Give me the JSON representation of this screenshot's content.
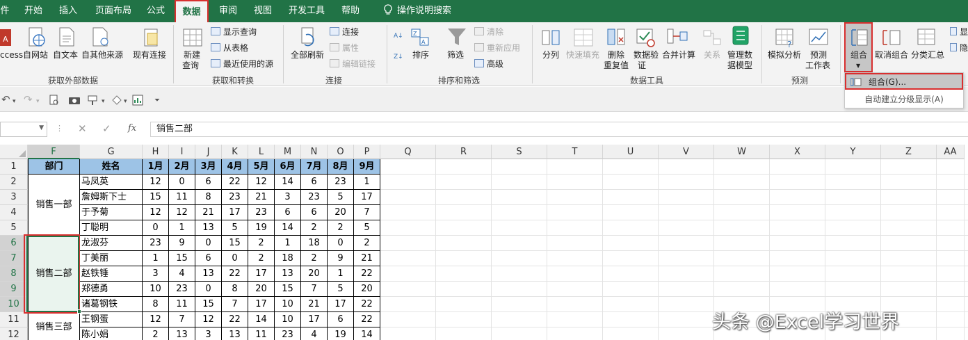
{
  "tabs": [
    {
      "label": "件"
    },
    {
      "label": "开始"
    },
    {
      "label": "插入"
    },
    {
      "label": "页面布局"
    },
    {
      "label": "公式"
    },
    {
      "label": "数据"
    },
    {
      "label": "审阅"
    },
    {
      "label": "视图"
    },
    {
      "label": "开发工具"
    },
    {
      "label": "帮助"
    }
  ],
  "tell_me": "操作说明搜索",
  "ribbon": {
    "ext": {
      "access": "ccess",
      "web": "自网站",
      "text": "自文本",
      "other": "自其他来源",
      "existing": "现有连接",
      "group": "获取外部数据"
    },
    "transform": {
      "new_query_l1": "新建",
      "new_query_l2": "查询",
      "show_query": "显示查询",
      "from_table": "从表格",
      "recent": "最近使用的源",
      "group": "获取和转换"
    },
    "conn": {
      "refresh_all": "全部刷新",
      "connections": "连接",
      "properties": "属性",
      "edit_links": "编辑链接",
      "group": "连接"
    },
    "sort": {
      "sort": "排序",
      "filter": "筛选",
      "clear": "清除",
      "reapply": "重新应用",
      "advanced": "高级",
      "group": "排序和筛选"
    },
    "tools": {
      "split": "分列",
      "flash_fill": "快速填充",
      "remove_dup_l1": "删除",
      "remove_dup_l2": "重复值",
      "validate_l1": "数据验",
      "validate_l2": "证",
      "consolidate": "合并计算",
      "relations": "关系",
      "model_l1": "管理数",
      "model_l2": "据模型",
      "group": "数据工具"
    },
    "forecast": {
      "whatif": "模拟分析",
      "sheet_l1": "预测",
      "sheet_l2": "工作表",
      "group": "预测"
    },
    "outline": {
      "group_btn": "组合",
      "ungroup": "取消组合",
      "subtotal": "分类汇总",
      "show": "显",
      "hide": "隐"
    }
  },
  "dropdown": {
    "group": "组合(G)...",
    "auto": "自动建立分级显示(A)"
  },
  "formula": {
    "value": "销售二部",
    "fx": "fx"
  },
  "col_headers": [
    {
      "label": "F",
      "w": 75
    },
    {
      "label": "G",
      "w": 90
    },
    {
      "label": "H",
      "w": 38
    },
    {
      "label": "I",
      "w": 38
    },
    {
      "label": "J",
      "w": 38
    },
    {
      "label": "K",
      "w": 38
    },
    {
      "label": "L",
      "w": 38
    },
    {
      "label": "M",
      "w": 38
    },
    {
      "label": "N",
      "w": 38
    },
    {
      "label": "O",
      "w": 38
    },
    {
      "label": "P",
      "w": 38
    },
    {
      "label": "Q",
      "w": 80
    },
    {
      "label": "R",
      "w": 80
    },
    {
      "label": "S",
      "w": 80
    },
    {
      "label": "T",
      "w": 80
    },
    {
      "label": "U",
      "w": 80
    },
    {
      "label": "V",
      "w": 80
    },
    {
      "label": "W",
      "w": 80
    },
    {
      "label": "X",
      "w": 80
    },
    {
      "label": "Y",
      "w": 80
    },
    {
      "label": "Z",
      "w": 80
    },
    {
      "label": "AA",
      "w": 40
    }
  ],
  "row_numbers": [
    "1",
    "2",
    "3",
    "4",
    "5",
    "6",
    "7",
    "8",
    "9",
    "10",
    "11",
    "12"
  ],
  "header_row": [
    "部门",
    "姓名",
    "1月",
    "2月",
    "3月",
    "4月",
    "5月",
    "6月",
    "7月",
    "8月",
    "9月"
  ],
  "departments": [
    {
      "name": "销售一部",
      "start": 1,
      "span": 4
    },
    {
      "name": "销售二部",
      "start": 5,
      "span": 5
    },
    {
      "name": "销售三部",
      "start": 10,
      "span": 2
    }
  ],
  "rows": [
    {
      "name": "马凤英",
      "m": [
        "12",
        "0",
        "6",
        "22",
        "12",
        "14",
        "6",
        "23",
        "1"
      ]
    },
    {
      "name": "詹姆斯下士",
      "m": [
        "15",
        "11",
        "8",
        "23",
        "21",
        "3",
        "23",
        "5",
        "17"
      ]
    },
    {
      "name": "于予菊",
      "m": [
        "12",
        "12",
        "21",
        "17",
        "23",
        "6",
        "6",
        "20",
        "7"
      ]
    },
    {
      "name": "丁聪明",
      "m": [
        "0",
        "1",
        "13",
        "5",
        "19",
        "14",
        "2",
        "2",
        "5"
      ]
    },
    {
      "name": "龙淑芬",
      "m": [
        "23",
        "9",
        "0",
        "15",
        "2",
        "1",
        "18",
        "0",
        "2"
      ]
    },
    {
      "name": "丁美丽",
      "m": [
        "1",
        "15",
        "6",
        "0",
        "2",
        "18",
        "2",
        "9",
        "21"
      ]
    },
    {
      "name": "赵铁锤",
      "m": [
        "3",
        "4",
        "13",
        "22",
        "17",
        "13",
        "20",
        "1",
        "22"
      ]
    },
    {
      "name": "郑德勇",
      "m": [
        "10",
        "23",
        "0",
        "8",
        "20",
        "15",
        "7",
        "5",
        "20"
      ]
    },
    {
      "name": "诸葛钢铁",
      "m": [
        "8",
        "11",
        "15",
        "7",
        "17",
        "10",
        "21",
        "17",
        "22"
      ]
    },
    {
      "name": "王钢蛋",
      "m": [
        "12",
        "7",
        "12",
        "22",
        "14",
        "10",
        "17",
        "6",
        "22"
      ]
    },
    {
      "name": "陈小娟",
      "m": [
        "2",
        "13",
        "3",
        "13",
        "11",
        "23",
        "4",
        "19",
        "14"
      ]
    }
  ],
  "watermark": "头条 @Excel学习世界",
  "colors": {
    "excel_green": "#217346",
    "header_blue": "#9dc3e6",
    "highlight_red": "#d92f2f"
  }
}
